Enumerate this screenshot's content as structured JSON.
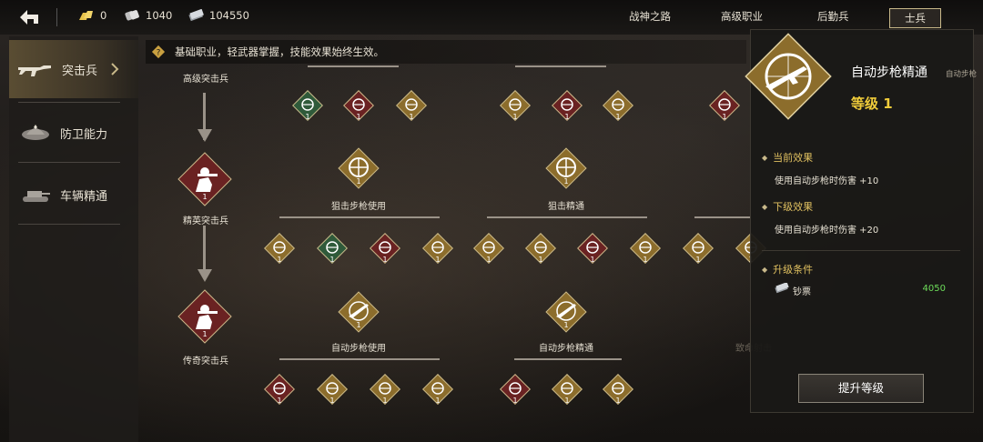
{
  "topbar": {
    "gold": "0",
    "dogtags": "1040",
    "cash": "104550",
    "tabs": [
      "战神之路",
      "高级职业",
      "后勤兵",
      "士兵"
    ],
    "active_tab": "士兵"
  },
  "sidebar": {
    "items": [
      {
        "label": "突击兵",
        "icon": "rifle-icon",
        "active": true
      },
      {
        "label": "防卫能力",
        "icon": "helmet-icon",
        "active": false
      },
      {
        "label": "车辆精通",
        "icon": "tank-icon",
        "active": false
      }
    ]
  },
  "hint": "基础职业，轻武器掌握，技能效果始终生效。",
  "tree": {
    "ranks": [
      {
        "label": "高级突击兵",
        "level": ""
      },
      {
        "label": "精英突击兵",
        "level": "1"
      },
      {
        "label": "传奇突击兵",
        "level": "1"
      }
    ],
    "skills": [
      {
        "label": "狙击步枪使用",
        "level": "1"
      },
      {
        "label": "狙击精通",
        "level": "1"
      },
      {
        "label": "自动步枪使用",
        "level": "1"
      },
      {
        "label": "自动步枪精通",
        "level": "1"
      },
      {
        "label": "致命射击",
        "level": ""
      }
    ],
    "sub_level": "1"
  },
  "panel": {
    "title": "自动步枪精通",
    "subtitle": "自动步枪",
    "level": "等级 1",
    "current_header": "当前效果",
    "current_text": "使用自动步枪时伤害 +10",
    "next_header": "下级效果",
    "next_text": "使用自动步枪时伤害 +20",
    "req_header": "升级条件",
    "req_item": "钞票",
    "req_value": "4050",
    "upgrade_button": "提升等级"
  },
  "colors": {
    "gold_dia": "#8c6d2c",
    "green_dia": "#2f5a3a",
    "red_dia": "#6a2222",
    "accent_text": "#f0cc3a",
    "cost_green": "#6ddc5a"
  }
}
